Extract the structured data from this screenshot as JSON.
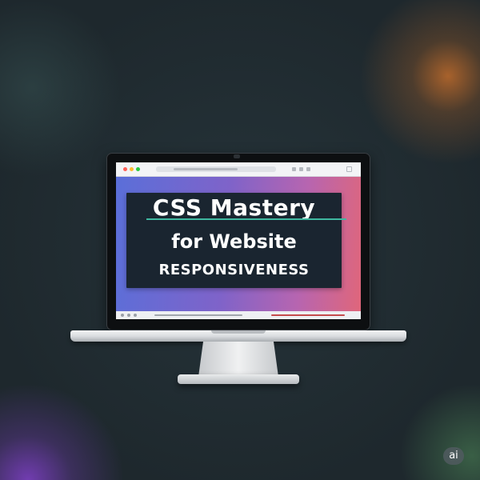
{
  "scene": {
    "background_color": "#1f2a2f",
    "glow_colors": [
      "#d6752b",
      "#8040c8",
      "#508c5a"
    ]
  },
  "browser": {
    "window_controls": [
      "close",
      "minimize",
      "maximize"
    ],
    "control_colors": [
      "#ff5f57",
      "#febc2e",
      "#28c840"
    ]
  },
  "screen": {
    "gradient_start": "#5a6fd9",
    "gradient_end": "#e0667a",
    "title_line_1": "CSS Mastery",
    "title_line_2": "for Website",
    "title_line_3": "RESPONSIVENESS",
    "accent_color": "#3fb8a0"
  },
  "badge": {
    "label": "ai"
  }
}
